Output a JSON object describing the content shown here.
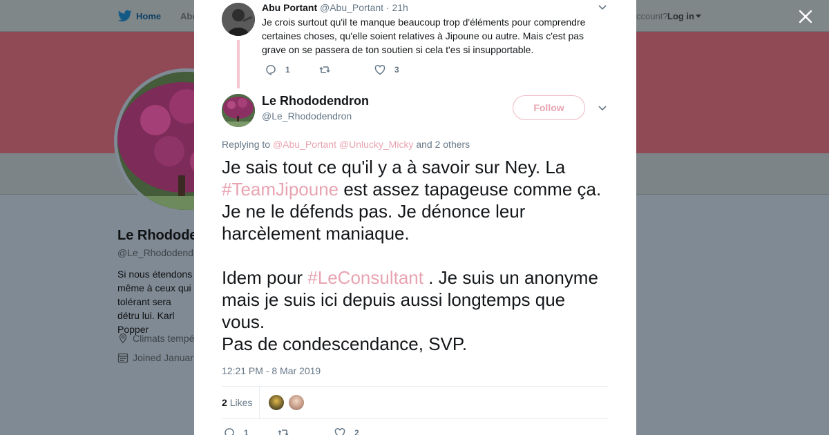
{
  "topnav": {
    "home_label": "Home",
    "about_label": "Abo",
    "account_text": "ccount?",
    "login_label": "Log in"
  },
  "profile": {
    "name": "Le Rhodode",
    "handle": "@Le_Rhododendr",
    "bio": "Si nous étendons même à ceux qui tolérant sera détru lui. Karl Popper",
    "location": "Climats tempé",
    "joined": "Joined Januar"
  },
  "reply_tweet": {
    "name": "Abu Portant",
    "handle": "@Abu_Portant",
    "time": "· 21h",
    "text": "Je crois surtout qu'il te manque beaucoup trop d'éléments pour comprendre certaines choses, qu'elle soient relatives à Jipoune ou autre. Mais c'est pas grave on se passera de ton soutien si cela t'es si insupportable.",
    "reply_count": "1",
    "retweet_count": "",
    "like_count": "3"
  },
  "main_tweet": {
    "name": "Le Rhododendron",
    "handle": "@Le_Rhododendron",
    "follow_label": "Follow",
    "replying_prefix": "Replying to",
    "mention_1": "@Abu_Portant",
    "mention_2": "@Unlucky_Micky",
    "replying_suffix": "and 2 others",
    "text_1": "Je sais tout ce qu'il y a à savoir sur Ney.  La ",
    "hashtag_1": "#TeamJipoune",
    "text_2": " est assez tapageuse comme ça. Je ne le défends pas. Je dénonce leur harcèlement maniaque.",
    "text_3": "Idem pour ",
    "hashtag_2": "#LeConsultant",
    "text_4": " . Je suis un anonyme mais je suis ici depuis aussi longtemps que vous.",
    "text_5": "Pas de condescendance, SVP.",
    "timestamp": "12:21 PM - 8 Mar 2019",
    "likes_count": "2",
    "likes_label": "Likes",
    "reply_count": "1",
    "retweet_count": "",
    "like_count": "2"
  },
  "colors": {
    "accent": "#e8a3b1",
    "overlay": "#7f8a95",
    "thread_line": "#f5c5d0"
  }
}
